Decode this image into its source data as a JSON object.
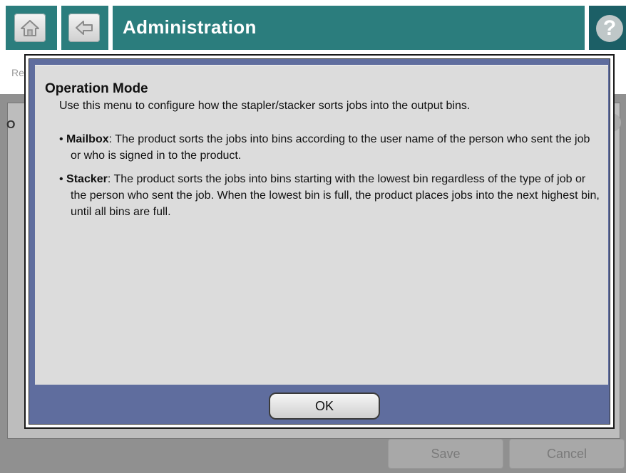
{
  "header": {
    "title": "Administration",
    "help_glyph": "?"
  },
  "underlay": {
    "strip_peek": "Re",
    "panel_peek": "O",
    "save_label": "Save",
    "cancel_label": "Cancel"
  },
  "modal": {
    "title": "Operation Mode",
    "description": "Use this menu to configure how the stapler/stacker sorts jobs into the output bins.",
    "bullets": [
      {
        "term": "Mailbox",
        "text": ": The product sorts the jobs into bins according to the user name of the person who sent the job or who is signed in to the product."
      },
      {
        "term": "Stacker",
        "text": ": The product sorts the jobs into bins starting with the lowest bin regardless of the type of job or the person who sent the job. When the lowest bin is full, the product places jobs into the next highest bin, until all bins are full."
      }
    ],
    "ok_label": "OK"
  },
  "icons": {
    "home": "home-icon",
    "back": "back-arrow-icon",
    "help": "help-icon"
  },
  "colors": {
    "header_teal": "#2b7d7d",
    "modal_frame": "#5f6d9e",
    "modal_content": "#dcdcdc"
  }
}
